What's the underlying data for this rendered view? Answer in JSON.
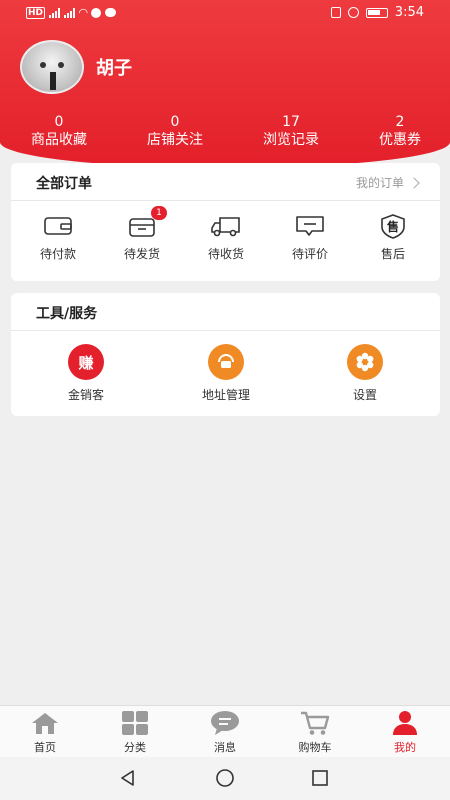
{
  "status_bar": {
    "left_text": "HD",
    "time": "3:54"
  },
  "profile": {
    "username": "胡子"
  },
  "stats": [
    {
      "value": "0",
      "label": "商品收藏"
    },
    {
      "value": "0",
      "label": "店铺关注"
    },
    {
      "value": "17",
      "label": "浏览记录"
    },
    {
      "value": "2",
      "label": "优惠券"
    }
  ],
  "orders_card": {
    "title": "全部订单",
    "link": "我的订单",
    "items": [
      {
        "label": "待付款",
        "icon": "wallet-icon"
      },
      {
        "label": "待发货",
        "icon": "box-icon",
        "badge": "1"
      },
      {
        "label": "待收货",
        "icon": "truck-icon"
      },
      {
        "label": "待评价",
        "icon": "comment-icon"
      },
      {
        "label": "售后",
        "icon": "aftersale-icon",
        "icon_text": "售"
      }
    ]
  },
  "tools_card": {
    "title": "工具/服务",
    "items": [
      {
        "label": "金销客",
        "icon": "earn-icon",
        "icon_text": "赚",
        "color": "#e3202c"
      },
      {
        "label": "地址管理",
        "icon": "address-icon",
        "color": "#f08a24"
      },
      {
        "label": "设置",
        "icon": "settings-icon",
        "color": "#f08a24"
      }
    ]
  },
  "tabbar": [
    {
      "label": "首页",
      "icon": "home-icon"
    },
    {
      "label": "分类",
      "icon": "category-icon"
    },
    {
      "label": "消息",
      "icon": "message-icon"
    },
    {
      "label": "购物车",
      "icon": "cart-icon"
    },
    {
      "label": "我的",
      "icon": "user-icon",
      "active": true
    }
  ],
  "colors": {
    "brand": "#e3202c",
    "accent": "#f08a24"
  }
}
